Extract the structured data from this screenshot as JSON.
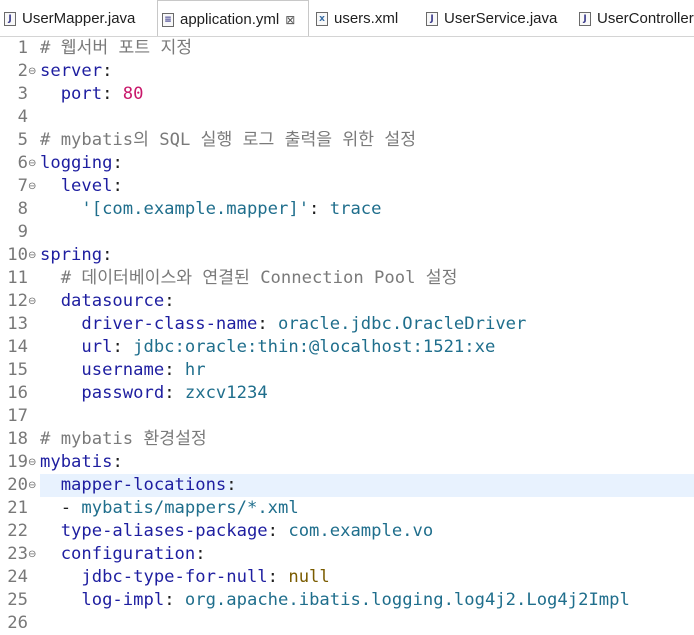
{
  "tabs": [
    {
      "label": "UserMapper.java",
      "icon": "java-file-icon",
      "active": false
    },
    {
      "label": "application.yml",
      "icon": "yml-file-icon",
      "active": true,
      "close": "⊠"
    },
    {
      "label": "users.xml",
      "icon": "xml-file-icon",
      "active": false
    },
    {
      "label": "UserService.java",
      "icon": "java-file-icon",
      "active": false
    },
    {
      "label": "UserController",
      "icon": "java-file-icon",
      "active": false
    }
  ],
  "editor": {
    "highlighted_line": 20,
    "lines": [
      {
        "n": "1",
        "fold": "",
        "tokens": [
          {
            "t": "# 웹서버 포트 지정",
            "c": "cmt"
          }
        ]
      },
      {
        "n": "2",
        "fold": "⊖",
        "tokens": [
          {
            "t": "server",
            "c": "key"
          },
          {
            "t": ":",
            "c": "punc"
          }
        ]
      },
      {
        "n": "3",
        "fold": "",
        "tokens": [
          {
            "t": "  port",
            "c": "key"
          },
          {
            "t": ": ",
            "c": "punc"
          },
          {
            "t": "80",
            "c": "num"
          }
        ]
      },
      {
        "n": "4",
        "fold": "",
        "tokens": []
      },
      {
        "n": "5",
        "fold": "",
        "tokens": [
          {
            "t": "# mybatis의 SQL 실행 로그 출력을 위한 설정",
            "c": "cmt"
          }
        ]
      },
      {
        "n": "6",
        "fold": "⊖",
        "tokens": [
          {
            "t": "logging",
            "c": "key"
          },
          {
            "t": ":",
            "c": "punc"
          }
        ]
      },
      {
        "n": "7",
        "fold": "⊖",
        "tokens": [
          {
            "t": "  level",
            "c": "key"
          },
          {
            "t": ":",
            "c": "punc"
          }
        ]
      },
      {
        "n": "8",
        "fold": "",
        "tokens": [
          {
            "t": "    '[com.example.mapper]'",
            "c": "str"
          },
          {
            "t": ": ",
            "c": "punc"
          },
          {
            "t": "trace",
            "c": "val"
          }
        ]
      },
      {
        "n": "9",
        "fold": "",
        "tokens": []
      },
      {
        "n": "10",
        "fold": "⊖",
        "tokens": [
          {
            "t": "spring",
            "c": "key"
          },
          {
            "t": ":",
            "c": "punc"
          }
        ]
      },
      {
        "n": "11",
        "fold": "",
        "tokens": [
          {
            "t": "  # 데이터베이스와 연결된 Connection Pool 설정",
            "c": "cmt"
          }
        ]
      },
      {
        "n": "12",
        "fold": "⊖",
        "tokens": [
          {
            "t": "  datasource",
            "c": "key"
          },
          {
            "t": ":",
            "c": "punc"
          }
        ]
      },
      {
        "n": "13",
        "fold": "",
        "tokens": [
          {
            "t": "    driver-class-name",
            "c": "key"
          },
          {
            "t": ": ",
            "c": "punc"
          },
          {
            "t": "oracle.jdbc.OracleDriver",
            "c": "val"
          }
        ]
      },
      {
        "n": "14",
        "fold": "",
        "tokens": [
          {
            "t": "    url",
            "c": "key"
          },
          {
            "t": ": ",
            "c": "punc"
          },
          {
            "t": "jdbc:oracle:thin:@localhost:1521:xe",
            "c": "val"
          }
        ]
      },
      {
        "n": "15",
        "fold": "",
        "tokens": [
          {
            "t": "    username",
            "c": "key"
          },
          {
            "t": ": ",
            "c": "punc"
          },
          {
            "t": "hr",
            "c": "val"
          }
        ]
      },
      {
        "n": "16",
        "fold": "",
        "tokens": [
          {
            "t": "    password",
            "c": "key"
          },
          {
            "t": ": ",
            "c": "punc"
          },
          {
            "t": "zxcv1234",
            "c": "val"
          }
        ]
      },
      {
        "n": "17",
        "fold": "",
        "tokens": []
      },
      {
        "n": "18",
        "fold": "",
        "tokens": [
          {
            "t": "# mybatis 환경설정",
            "c": "cmt"
          }
        ]
      },
      {
        "n": "19",
        "fold": "⊖",
        "tokens": [
          {
            "t": "mybatis",
            "c": "key"
          },
          {
            "t": ":",
            "c": "punc"
          }
        ]
      },
      {
        "n": "20",
        "fold": "⊖",
        "tokens": [
          {
            "t": "  mapper-locations",
            "c": "key"
          },
          {
            "t": ":",
            "c": "punc"
          }
        ]
      },
      {
        "n": "21",
        "fold": "",
        "tokens": [
          {
            "t": "  - ",
            "c": "punc"
          },
          {
            "t": "mybatis/mappers/*.xml",
            "c": "val"
          }
        ]
      },
      {
        "n": "22",
        "fold": "",
        "tokens": [
          {
            "t": "  type-aliases-package",
            "c": "key"
          },
          {
            "t": ": ",
            "c": "punc"
          },
          {
            "t": "com.example.vo",
            "c": "val"
          }
        ]
      },
      {
        "n": "23",
        "fold": "⊖",
        "tokens": [
          {
            "t": "  configuration",
            "c": "key"
          },
          {
            "t": ":",
            "c": "punc"
          }
        ]
      },
      {
        "n": "24",
        "fold": "",
        "tokens": [
          {
            "t": "    jdbc-type-for-null",
            "c": "key"
          },
          {
            "t": ": ",
            "c": "punc"
          },
          {
            "t": "null",
            "c": "nul"
          }
        ]
      },
      {
        "n": "25",
        "fold": "",
        "tokens": [
          {
            "t": "    log-impl",
            "c": "key"
          },
          {
            "t": ": ",
            "c": "punc"
          },
          {
            "t": "org.apache.ibatis.logging.log4j2.Log4j2Impl",
            "c": "val"
          }
        ]
      },
      {
        "n": "26",
        "fold": "",
        "tokens": []
      }
    ]
  }
}
